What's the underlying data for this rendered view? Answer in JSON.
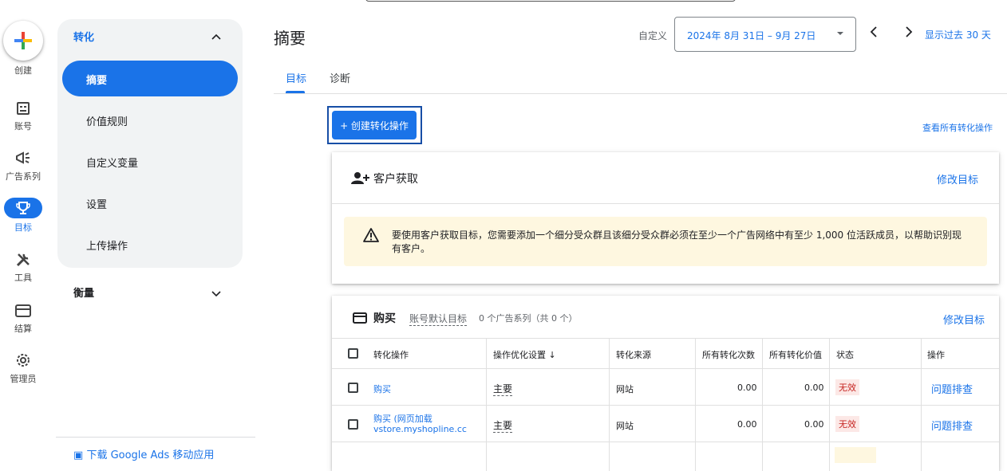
{
  "rail": {
    "create": "创建",
    "items": [
      {
        "label": "账号",
        "icon": "account-icon"
      },
      {
        "label": "广告系列",
        "icon": "campaign-megaphone-icon"
      },
      {
        "label": "目标",
        "icon": "trophy-icon"
      },
      {
        "label": "工具",
        "icon": "tools-icon"
      },
      {
        "label": "结算",
        "icon": "billing-card-icon"
      },
      {
        "label": "管理员",
        "icon": "admin-gear-icon"
      }
    ]
  },
  "subnav": {
    "section": "转化",
    "items": [
      "摘要",
      "价值规则",
      "自定义变量",
      "设置",
      "上传操作"
    ],
    "measure": "衡量",
    "download": "下载 Google Ads 移动应用"
  },
  "header": {
    "title": "摘要",
    "custom_label": "自定义",
    "date_range": "2024年 8月 31日 – 9月 27日",
    "show_past": "显示过去 30 天"
  },
  "tabs": [
    "目标",
    "诊断"
  ],
  "toolbar": {
    "create_conversion": "+ 创建转化操作",
    "view_all": "查看所有转化操作"
  },
  "acquisition_card": {
    "title": "客户获取",
    "edit": "修改目标",
    "warning": "要使用客户获取目标，您需要添加一个细分受众群且该细分受众群必须在至少一个广告网络中有至少 1,000 位活跃成员，以帮助识别现有客户。"
  },
  "purchase_card": {
    "title": "购买",
    "default_goal": "账号默认目标",
    "campaigns": "0 个广告系列（共 0 个）",
    "edit": "修改目标",
    "columns": [
      "转化操作",
      "操作优化设置 ↓",
      "转化来源",
      "所有转化次数",
      "所有转化价值",
      "状态",
      "操作"
    ],
    "rows": [
      {
        "name": "购买",
        "name2": "",
        "opt": "主要",
        "source": "网站",
        "count": "0.00",
        "value": "0.00",
        "status": "无效",
        "action": "问题排查"
      },
      {
        "name": "购买 (网页加载",
        "name2": "vstore.myshopline.cc",
        "opt": "主要",
        "source": "网站",
        "count": "0.00",
        "value": "0.00",
        "status": "无效",
        "action": "问题排查"
      }
    ]
  },
  "colors": {
    "accent": "#1a73e8",
    "warning_bg": "#fef7e0",
    "error": "#c5221f"
  }
}
